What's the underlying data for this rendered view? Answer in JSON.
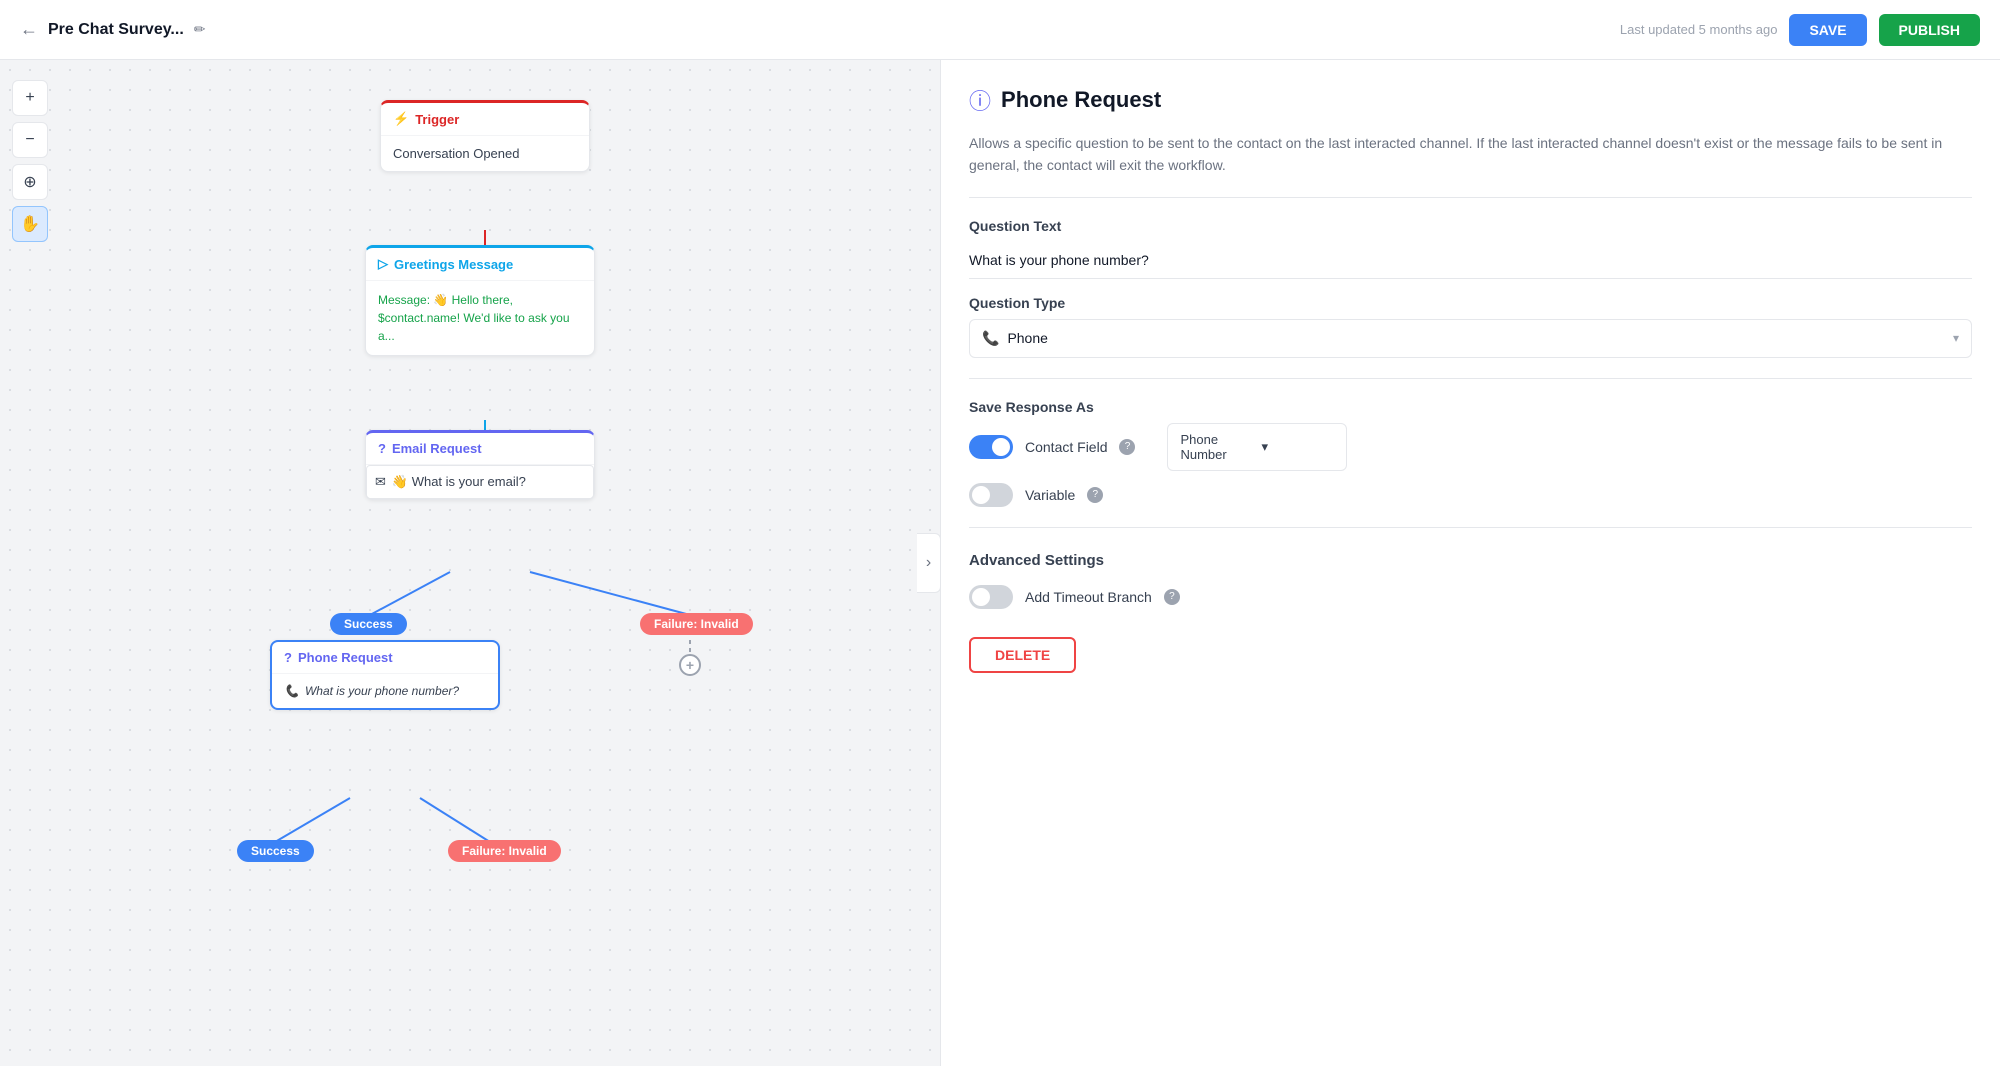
{
  "header": {
    "back_label": "←",
    "title": "Pre Chat Survey...",
    "edit_icon": "✏",
    "last_updated": "Last updated 5 months ago",
    "save_label": "SAVE",
    "publish_label": "PUBLISH"
  },
  "tools": [
    {
      "name": "zoom-in",
      "icon": "+"
    },
    {
      "name": "zoom-out",
      "icon": "−"
    },
    {
      "name": "target",
      "icon": "⊕"
    },
    {
      "name": "hand",
      "icon": "✋"
    }
  ],
  "canvas": {
    "trigger_node": {
      "header": "Trigger",
      "body": "Conversation Opened"
    },
    "greetings_node": {
      "header": "Greetings Message",
      "body": "Message: 👋 Hello there, $contact.name! We'd like to ask you a..."
    },
    "email_node": {
      "header": "Email Request",
      "body_icon": "✉",
      "body_text": "👋 What is your email?"
    },
    "phone_node": {
      "header": "Phone Request",
      "body_text": "What is your phone number?"
    },
    "badges": {
      "success1": "Success",
      "failure1": "Failure: Invalid",
      "success2": "Success",
      "failure2": "Failure: Invalid"
    }
  },
  "right_panel": {
    "title": "Phone Request",
    "description": "Allows a specific question to be sent to the contact on the last interacted channel. If the last interacted channel doesn't exist or the message fails to be sent in general, the contact will exit the workflow.",
    "question_text_label": "Question Text",
    "question_text_value": "What is your phone number?",
    "question_type_label": "Question Type",
    "question_type_value": "Phone",
    "save_response_label": "Save Response As",
    "contact_field_label": "Contact Field",
    "phone_number_label": "Phone Number",
    "variable_label": "Variable",
    "advanced_settings_label": "Advanced Settings",
    "add_timeout_label": "Add Timeout Branch",
    "delete_label": "DELETE"
  }
}
